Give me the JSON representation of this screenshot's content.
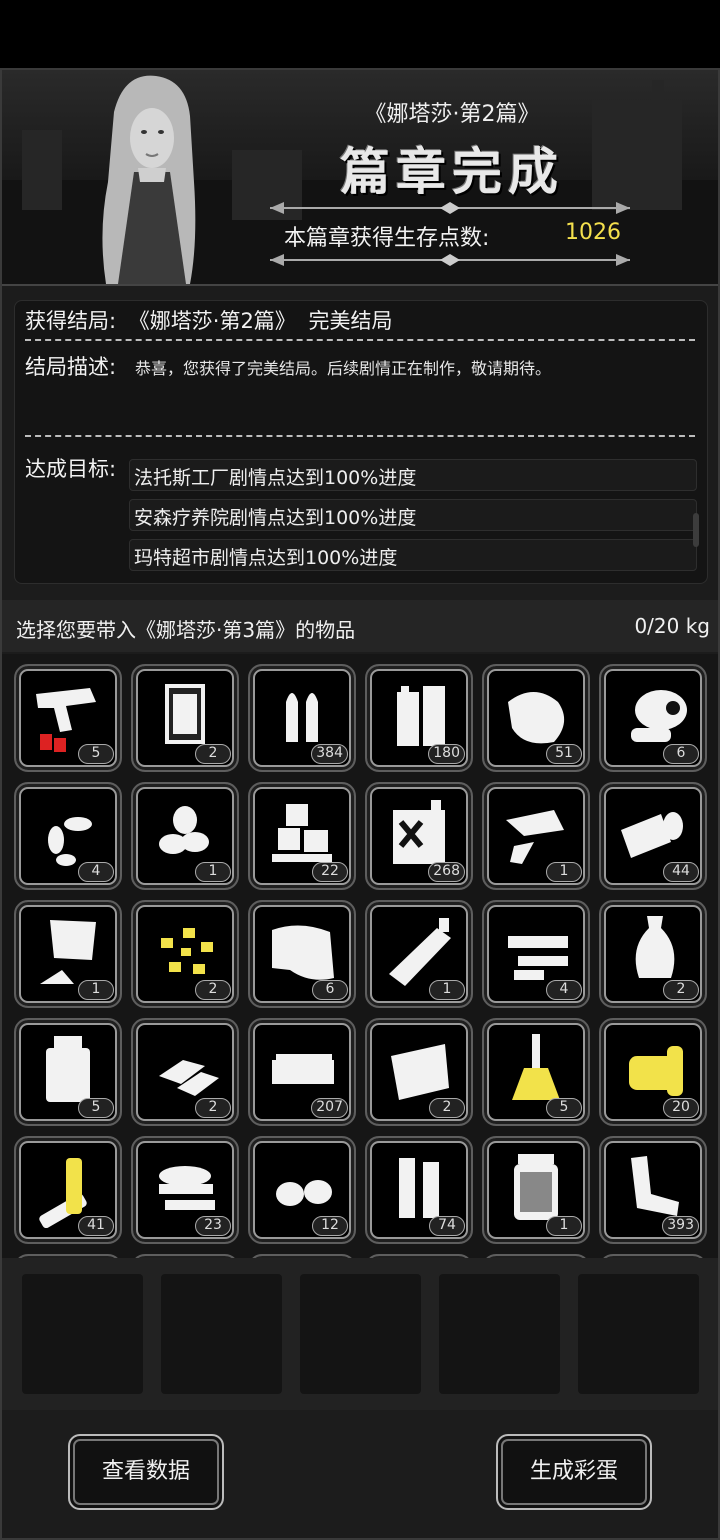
{
  "header": {
    "chapter_name": "《娜塔莎·第2篇》",
    "complete_title": "篇章完成",
    "score_label": "本篇章获得生存点数:",
    "score_value": "1026"
  },
  "result": {
    "ending_label": "获得结局:",
    "ending_chapter": "《娜塔莎·第2篇》",
    "ending_name": "完美结局",
    "desc_label": "结局描述:",
    "desc_text": "恭喜，您获得了完美结局。后续剧情正在制作，敬请期待。",
    "goal_label": "达成目标:",
    "goals": [
      "法托斯工厂剧情点达到100%进度",
      "安森疗养院剧情点达到100%进度",
      "玛特超市剧情点达到100%进度"
    ]
  },
  "select": {
    "title": "选择您要带入《娜塔莎·第3篇》的物品",
    "weight": "0/20 kg"
  },
  "items": [
    {
      "icon": "flare-gun-icon",
      "qty": "5"
    },
    {
      "icon": "book-icon",
      "qty": "2"
    },
    {
      "icon": "bullets-icon",
      "qty": "384"
    },
    {
      "icon": "battery-pack-icon",
      "qty": "180"
    },
    {
      "icon": "meat-icon",
      "qty": "51"
    },
    {
      "icon": "chicken-leg-icon",
      "qty": "6"
    },
    {
      "icon": "seeds-icon",
      "qty": "4"
    },
    {
      "icon": "beans-icon",
      "qty": "1"
    },
    {
      "icon": "ice-cubes-icon",
      "qty": "22"
    },
    {
      "icon": "fuel-can-icon",
      "qty": "268"
    },
    {
      "icon": "metal-scraps-icon",
      "qty": "1"
    },
    {
      "icon": "bandage-roll-icon",
      "qty": "44"
    },
    {
      "icon": "flour-bag-icon",
      "qty": "1"
    },
    {
      "icon": "gold-nuggets-icon",
      "qty": "2"
    },
    {
      "icon": "cloth-icon",
      "qty": "6"
    },
    {
      "icon": "glue-tube-icon",
      "qty": "1"
    },
    {
      "icon": "rifle-parts-icon",
      "qty": "4"
    },
    {
      "icon": "vase-icon",
      "qty": "2"
    },
    {
      "icon": "medicine-bottle-icon",
      "qty": "5"
    },
    {
      "icon": "silver-bars-icon",
      "qty": "2"
    },
    {
      "icon": "cash-stack-icon",
      "qty": "207"
    },
    {
      "icon": "sheet-metal-icon",
      "qty": "2"
    },
    {
      "icon": "flask-icon",
      "qty": "5"
    },
    {
      "icon": "gold-spool-icon",
      "qty": "20"
    },
    {
      "icon": "batteries-icon",
      "qty": "41"
    },
    {
      "icon": "tape-roll-icon",
      "qty": "23"
    },
    {
      "icon": "potatoes-icon",
      "qty": "12"
    },
    {
      "icon": "shell-casings-icon",
      "qty": "74"
    },
    {
      "icon": "pickle-jar-icon",
      "qty": "1"
    },
    {
      "icon": "scrap-pipe-icon",
      "qty": "393"
    }
  ],
  "buttons": {
    "view_data": "查看数据",
    "generate_egg": "生成彩蛋"
  },
  "colors": {
    "score": "#f4e04d",
    "accent_yellow": "#f2e24a"
  }
}
